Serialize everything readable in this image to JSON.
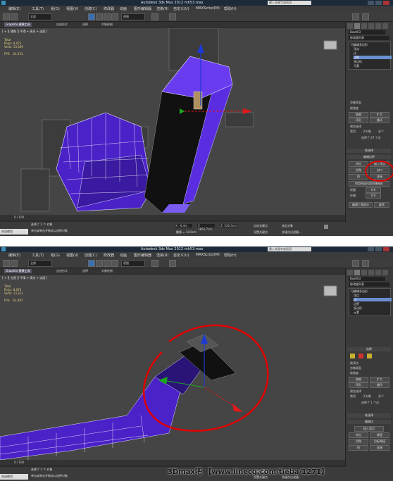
{
  "window": {
    "title_1": "Autodesk 3ds Max 2012    mh53.max",
    "title_2": "Autodesk 3ds Max  2012    mh53.max",
    "search_placeholder": "键入关键字或短语"
  },
  "menu": [
    "编辑(E)",
    "工具(T)",
    "组(G)",
    "视图(V)",
    "创建(C)",
    "修改器",
    "动画",
    "图形编辑器",
    "渲染(R)",
    "自定义(U)",
    "MAXScript(M)",
    "帮助(H)"
  ],
  "toolbar": {
    "filter_value": "全部",
    "view_value": "视图"
  },
  "ribbon": {
    "tabs": [
      "Graphite 建模工具",
      "自由形式",
      "选择",
      "对象绘制"
    ]
  },
  "shot1": {
    "viewport_label": "[ + ][ 透视 ][ 平滑 + 高光 + 边面 ]",
    "stats_total_label": "Total",
    "stats_polys": "Polys: 8,073",
    "stats_verts": "Verts: 13,309",
    "stats_fps": "FPS:   41.231",
    "panel": {
      "object_name": "Box003",
      "modifier_list": "修改器列表",
      "stack": [
        "可编辑多边形",
        "顶点",
        "边",
        "边界",
        "多边形",
        "元素"
      ],
      "selected_stack_index": 3,
      "sections": [
        "软选择",
        "编辑边界"
      ],
      "texts": [
        "忽略背面",
        "按角度",
        "收缩",
        "扩大",
        "环形",
        "循环",
        "预览选择",
        "禁用",
        "子对象",
        "多个",
        "选择了 27 个边",
        "挤出",
        "插入顶点",
        "切角",
        "封口",
        "桥",
        "连接",
        "利用所选内容创建图形",
        "权重:",
        "0.0",
        "折缝:",
        "0.0",
        "编辑三角剖分",
        "旋转"
      ]
    },
    "trackbar_frame": "0 / 100",
    "status": {
      "selected": "选择了 1 个 对象",
      "prompt": "单击或单击并拖动以选择对象",
      "maxscript": "欢迎使用 MAXScript。",
      "x": "X: -0.4m",
      "y": "Y: 1863.7cm",
      "z": "Z: 526.3cm",
      "grid": "栅格 = 10.0cm",
      "autokey": "自动关键点",
      "selected_mode": "选定对象",
      "setkey": "设置关键点",
      "keyfilter": "关键点过滤器..."
    }
  },
  "shot2": {
    "viewport_label": "[ + ][ 左视 ][ 平滑 + 高光 + 边面 ]",
    "stats_total_label": "Total",
    "stats_polys": "Polys: 8,073",
    "stats_verts": "Verts: 13,311",
    "stats_fps": "FPS:   61.087",
    "panel": {
      "object_name": "Box003",
      "modifier_list": "修改器列表",
      "stack": [
        "可编辑多边形",
        "顶点",
        "边",
        "边界",
        "多边形",
        "元素"
      ],
      "selected_stack_index": 2,
      "sections": [
        "选择",
        "软选择",
        "编辑边",
        "插入顶点"
      ],
      "texts": [
        "按顶点",
        "忽略背面",
        "按角度",
        "收缩",
        "扩大",
        "环形",
        "循环",
        "预览选择",
        "禁用",
        "子对象",
        "多个",
        "选择了 1 个边",
        "挤出",
        "焊接",
        "切角",
        "目标焊接",
        "桥",
        "连接"
      ]
    },
    "trackbar_frame": "0 / 100",
    "status": {
      "selected": "选择了 1 个 对象",
      "prompt": "单击或单击并拖动以选择对象",
      "maxscript": "欢迎使用 MAXScript。",
      "autokey": "自动关键点",
      "selected_mode": "选定对象",
      "setkey": "设置关键点",
      "keyfilter": "关键点过滤器..."
    }
  },
  "watermark": "3Dmax吧 【www.linecg.com/tieba/1271】",
  "colors": {
    "viewport_bg": "#454545",
    "mesh_purple": "#4b22c8",
    "mesh_highlight": "#7a5cf0",
    "gizmo_red": "#e01818",
    "gizmo_green": "#1fa81f",
    "gizmo_blue": "#1c3ad6",
    "annotation_red": "#e00000",
    "selection_blue": "#6a8fd0"
  },
  "icons": [
    "app-logo-icon",
    "minimize-icon",
    "maximize-icon",
    "close-icon",
    "undo-icon",
    "redo-icon",
    "select-icon",
    "move-icon",
    "rotate-icon",
    "scale-icon",
    "snap-icon",
    "render-icon",
    "viewcube-icon",
    "play-icon",
    "lock-icon",
    "key-icon"
  ]
}
